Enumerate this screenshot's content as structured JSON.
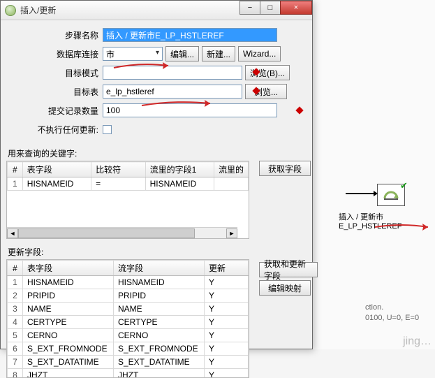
{
  "backdrop": {
    "node_label": "插入 / 更新市E_LP_HSTLEREF",
    "status1": "ction.",
    "status2": "0100, U=0, E=0",
    "watermark": "jing…"
  },
  "window": {
    "title": "插入/更新",
    "min_tip": "−",
    "max_tip": "□",
    "close_tip": "×"
  },
  "form": {
    "step_label": "步骤名称",
    "step_value": "插入 / 更新市E_LP_HSTLEREF",
    "conn_label": "数据库连接",
    "conn_value": "市",
    "edit_btn": "编辑...",
    "new_btn": "新建...",
    "wizard_btn": "Wizard...",
    "schema_label": "目标模式",
    "schema_value": "",
    "browse_b_btn": "浏览(B)...",
    "table_label": "目标表",
    "table_value": "e_lp_hstleref",
    "browse_btn": "浏览...",
    "commit_label": "提交记录数量",
    "commit_value": "100",
    "noupdate_label": "不执行任何更新:"
  },
  "query_section": {
    "label": "用来查询的关键字:",
    "get_fields_btn": "获取字段",
    "headers": {
      "num": "#",
      "field": "表字段",
      "op": "比较符",
      "s1": "流里的字段1",
      "s2": "流里的"
    },
    "rows": [
      {
        "n": "1",
        "field": "HISNAMEID",
        "op": "=",
        "s1": "HISNAMEID"
      }
    ]
  },
  "update_section": {
    "label": "更新字段:",
    "get_update_btn": "获取和更新字段",
    "edit_map_btn": "编辑映射",
    "headers": {
      "num": "#",
      "field": "表字段",
      "stream": "流字段",
      "upd": "更新"
    },
    "rows": [
      {
        "n": "1",
        "field": "HISNAMEID",
        "stream": "HISNAMEID",
        "upd": "Y"
      },
      {
        "n": "2",
        "field": "PRIPID",
        "stream": "PRIPID",
        "upd": "Y"
      },
      {
        "n": "3",
        "field": "NAME",
        "stream": "NAME",
        "upd": "Y"
      },
      {
        "n": "4",
        "field": "CERTYPE",
        "stream": "CERTYPE",
        "upd": "Y"
      },
      {
        "n": "5",
        "field": "CERNO",
        "stream": "CERNO",
        "upd": "Y"
      },
      {
        "n": "6",
        "field": "S_EXT_FROMNODE",
        "stream": "S_EXT_FROMNODE",
        "upd": "Y"
      },
      {
        "n": "7",
        "field": "S_EXT_DATATIME",
        "stream": "S_EXT_DATATIME",
        "upd": "Y"
      },
      {
        "n": "8",
        "field": "JHZT",
        "stream": "JHZT",
        "upd": "Y"
      }
    ]
  }
}
